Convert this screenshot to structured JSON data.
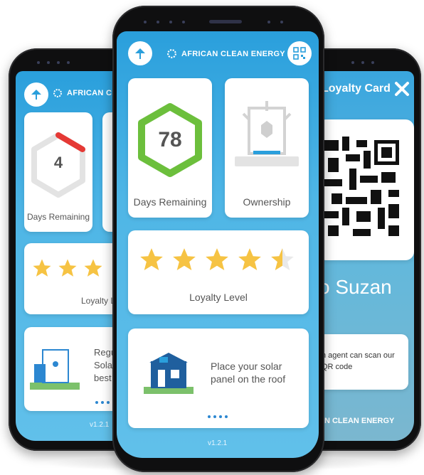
{
  "brand": {
    "name": "AFRICAN CLEAN ENERGY",
    "name_partial": "AFRICAN CLEA"
  },
  "left_phone": {
    "days_value": "4",
    "days_label": "Days Remaining",
    "loyalty_label": "Loyalty Lev",
    "tip_lines": [
      "Regula",
      "Solar p",
      "best ch"
    ],
    "version": "v1.2.1"
  },
  "center_phone": {
    "days_value": "78",
    "days_label": "Days Remaining",
    "ownership_label": "Ownership",
    "loyalty_label": "Loyalty Level",
    "tip_text": "Place your solar panel on the roof",
    "version": "v1.2.1"
  },
  "right_phone": {
    "title": "Loyalty Card",
    "greeting": "o Suzan",
    "scan_text": "n agent can scan our QR code",
    "brand_partial": "AN CLEAN ENERGY"
  },
  "colors": {
    "screen_blue": "#2a9fdc",
    "hexagon_green": "#6cbf3c",
    "hexagon_gray": "#e3e3e3",
    "hexagon_red": "#e53935",
    "star": "#f6c343",
    "accent_blue": "#2c87d1"
  },
  "icons": [
    "satellite-dish-icon",
    "sun-gear-icon",
    "qr-code-icon",
    "close-icon",
    "star-icon",
    "house-icon",
    "solar-panel-icon"
  ]
}
